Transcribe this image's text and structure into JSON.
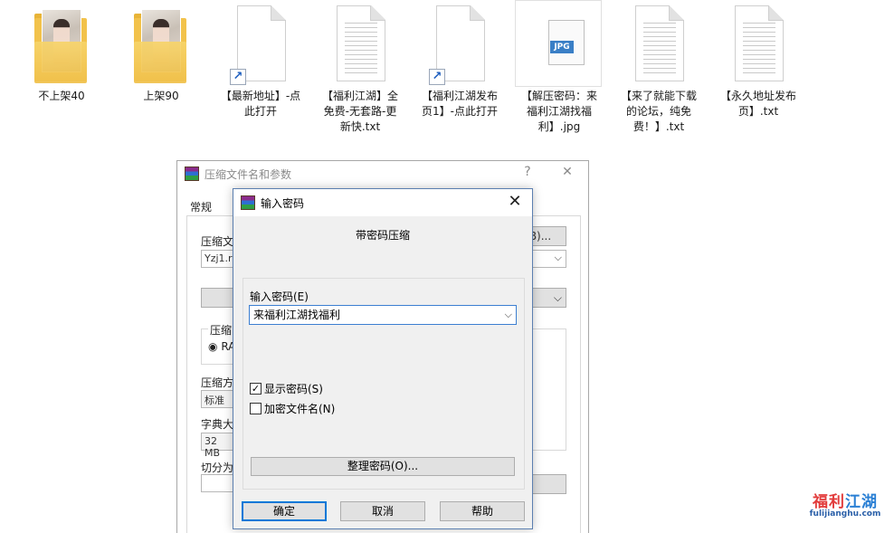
{
  "desktop": {
    "icons": [
      {
        "label": "不上架40",
        "type": "folder"
      },
      {
        "label": "上架90",
        "type": "folder"
      },
      {
        "label": "【最新地址】-点此打开",
        "type": "shortcut"
      },
      {
        "label": "【福利江湖】全免费-无套路-更新快.txt",
        "type": "text-file"
      },
      {
        "label": "【福利江湖发布页1】-点此打开",
        "type": "shortcut"
      },
      {
        "label": "【解压密码：来福利江湖找福利】.jpg",
        "type": "jpg-file",
        "badge": "JPG"
      },
      {
        "label": "【来了就能下载的论坛，纯免费！】.txt",
        "type": "text-file"
      },
      {
        "label": "【永久地址发布页】.txt",
        "type": "text-file"
      }
    ]
  },
  "background_dialog": {
    "title": "压缩文件名和参数",
    "help": "?",
    "close": "✕",
    "tab_general": "常规",
    "archive_name_label": "压缩文",
    "archive_name_value": "Yzj1.ra",
    "browse_button": "B)...",
    "format_group_label": "压缩",
    "format_radio": "RA",
    "method_label": "压缩方",
    "method_value": "标准",
    "dict_label": "字典大",
    "dict_value": "32 MB",
    "split_label": "切分为"
  },
  "password_dialog": {
    "title": "输入密码",
    "close": "✕",
    "heading": "带密码压缩",
    "password_label": "输入密码(E)",
    "password_value": "来福利江湖找福利",
    "show_password_label": "显示密码(S)",
    "show_password_checked": true,
    "encrypt_names_label": "加密文件名(N)",
    "encrypt_names_checked": false,
    "organize_button": "整理密码(O)...",
    "ok_button": "确定",
    "cancel_button": "取消",
    "help_button": "帮助"
  },
  "watermark": {
    "title_a": "福利",
    "title_b": "江湖",
    "url": "fulijianghu.com"
  }
}
